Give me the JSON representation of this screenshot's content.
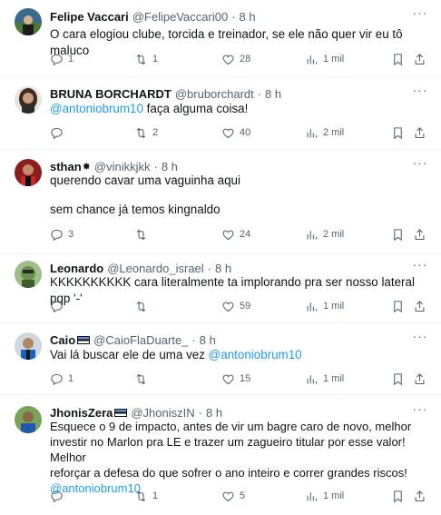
{
  "tweets": [
    {
      "name": "Felipe Vaccari",
      "handle": "@FelipeVaccari00",
      "dot": "·",
      "time": "8 h",
      "text": [
        "O cara elogiou clube, torcida e treinador, se ele não quer vir eu tô maluco"
      ],
      "stats": {
        "replies": "1",
        "retweets": "1",
        "likes": "28",
        "views": "1 mil"
      }
    },
    {
      "name": "BRUNA BORCHARDT",
      "handle": "@bruborchardt",
      "dot": "·",
      "time": "8 h",
      "mention": "@antoniobrum10",
      "text_after_mention": " faça alguma coisa!",
      "stats": {
        "replies": "",
        "retweets": "2",
        "likes": "40",
        "views": "2 mil"
      }
    },
    {
      "name": "sthan",
      "name_symbol": "✸",
      "handle": "@vinikkjkk",
      "dot": "·",
      "time": "8 h",
      "line1": "querendo cavar uma vaguinha aqui",
      "line2": "sem chance já temos kingnaldo",
      "stats": {
        "replies": "3",
        "retweets": "",
        "likes": "24",
        "views": "2 mil"
      }
    },
    {
      "name": "Leonardo",
      "handle": "@Leonardo_israel",
      "dot": "·",
      "time": "8 h",
      "text": [
        "KKKKKKKKKK cara literalmente ta implorando pra ser nosso lateral pqp '-'"
      ],
      "stats": {
        "replies": "",
        "retweets": "",
        "likes": "59",
        "views": "1 mil"
      }
    },
    {
      "name": "Caio",
      "handle": "@CaioFlaDuarte_",
      "dot": "·",
      "time": "8 h",
      "text_before_mention": "Vai lá buscar ele de uma vez ",
      "mention": "@antoniobrum10",
      "stats": {
        "replies": "1",
        "retweets": "",
        "likes": "15",
        "views": "1 mil"
      }
    },
    {
      "name": "JhonisZera",
      "handle": "@JhoniszIN",
      "dot": "·",
      "time": "8 h",
      "lines": [
        "Esquece o 9 de impacto, antes de vir um bagre caro de novo, melhor",
        "investir no Marlon pra LE e trazer um zagueiro titular por esse valor! Melhor",
        "reforçar a defesa do que sofrer o ano inteiro e correr grandes riscos!"
      ],
      "mention": "@antoniobrum10",
      "stats": {
        "replies": "",
        "retweets": "1",
        "likes": "5",
        "views": "1 mil"
      }
    }
  ],
  "icons": {
    "reply": "reply-icon",
    "retweet": "retweet-icon",
    "like": "heart-icon",
    "views": "views-icon",
    "bookmark": "bookmark-icon",
    "share": "share-icon",
    "more": "more-icon"
  },
  "more_glyph": "···",
  "accent_color": "#1d9bf0"
}
